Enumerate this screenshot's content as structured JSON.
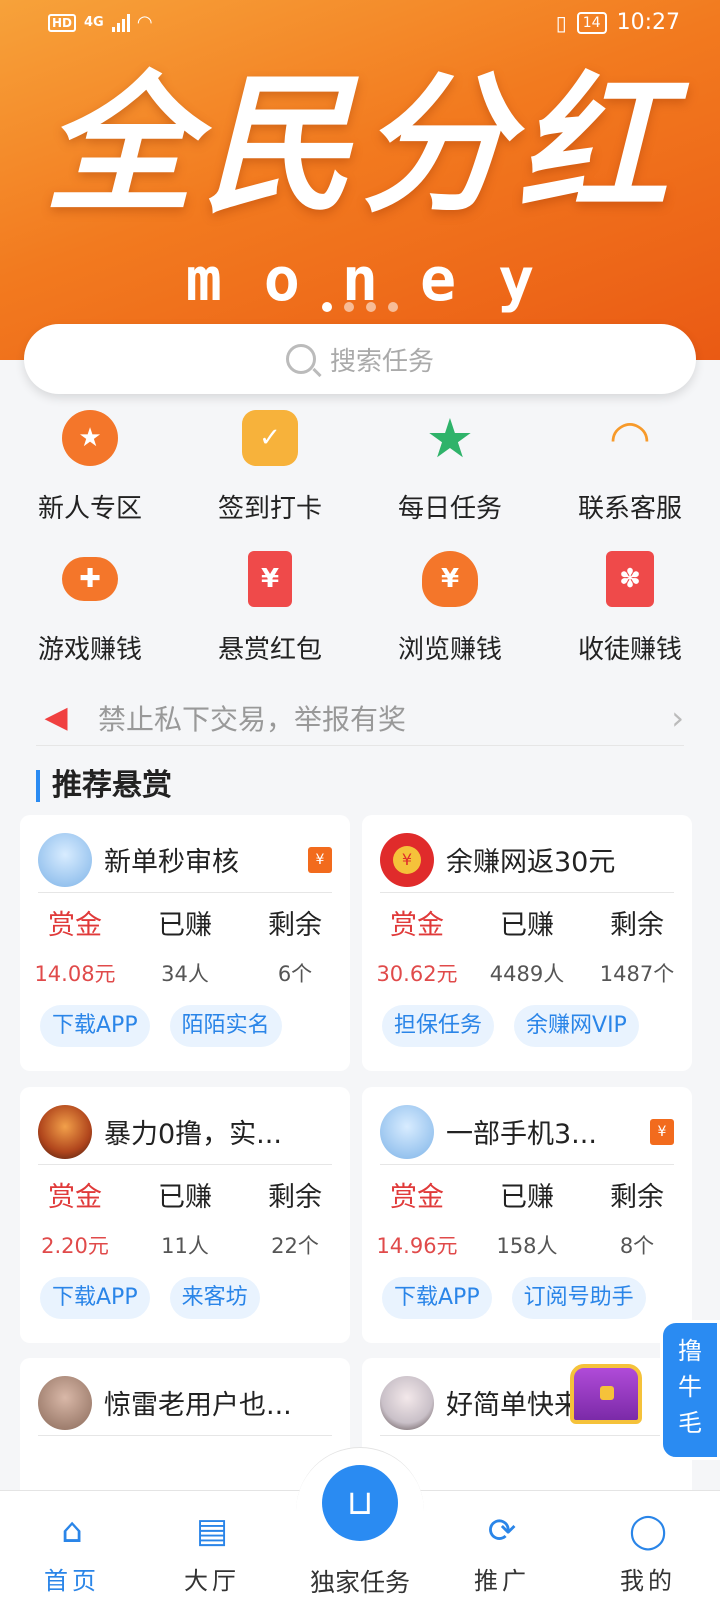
{
  "status_bar": {
    "network": "4G",
    "hd": "HD",
    "battery": "14",
    "time": "10:27"
  },
  "banner": {
    "title": "全民分红",
    "subtitle": "money"
  },
  "search": {
    "placeholder": "搜索任务"
  },
  "grid": [
    {
      "label": "新人专区",
      "icon": "medal-icon",
      "color": "#f4762a",
      "glyph": "★"
    },
    {
      "label": "签到打卡",
      "icon": "checkin-icon",
      "color": "#f7b23b",
      "glyph": "✓"
    },
    {
      "label": "每日任务",
      "icon": "star-icon",
      "color": "#2fb36a",
      "glyph": "★"
    },
    {
      "label": "联系客服",
      "icon": "headset-icon",
      "color": "#f79a2a",
      "glyph": "◠"
    },
    {
      "label": "游戏赚钱",
      "icon": "gamepad-icon",
      "color": "#f4762a",
      "glyph": "✚"
    },
    {
      "label": "悬赏红包",
      "icon": "red-packet-icon",
      "color": "#ef4a4a",
      "glyph": "¥"
    },
    {
      "label": "浏览赚钱",
      "icon": "money-bag-icon",
      "color": "#f4762a",
      "glyph": "¥"
    },
    {
      "label": "收徒赚钱",
      "icon": "gift-icon",
      "color": "#ef4a4a",
      "glyph": "✽"
    }
  ],
  "notice": {
    "text": "禁止私下交易，举报有奖"
  },
  "section": {
    "title": "推荐悬赏"
  },
  "stat_labels": {
    "reward": "赏金",
    "earned": "已赚",
    "remaining": "剩余"
  },
  "cards": [
    {
      "title": "新单秒审核",
      "reward": "14.08元",
      "earned": "34人",
      "remaining": "6个",
      "tags": [
        "下载APP",
        "陌陌实名"
      ],
      "avatar_color": "#7fb4e8",
      "red_packet": true
    },
    {
      "title": "余赚网返30元",
      "reward": "30.62元",
      "earned": "4489人",
      "remaining": "1487个",
      "tags": [
        "担保任务",
        "余赚网VIP"
      ],
      "avatar_color": "#e02b2b",
      "red_packet": false
    },
    {
      "title": "暴力0撸，实...",
      "reward": "2.20元",
      "earned": "11人",
      "remaining": "22个",
      "tags": [
        "下载APP",
        "来客坊"
      ],
      "avatar_color": "#b0451c",
      "red_packet": false
    },
    {
      "title": "一部手机3...",
      "reward": "14.96元",
      "earned": "158人",
      "remaining": "8个",
      "tags": [
        "下载APP",
        "订阅号助手"
      ],
      "avatar_color": "#7fb4e8",
      "red_packet": true
    },
    {
      "title": "惊雷老用户也...",
      "avatar_color": "#8a6a5a"
    },
    {
      "title": "好简单快来玩吖",
      "avatar_color": "#c9c0c8"
    }
  ],
  "float_button": {
    "label": "撸牛毛"
  },
  "tabbar": {
    "home": "首页",
    "hall": "大厅",
    "exclusive": "独家任务",
    "promote": "推广",
    "mine": "我的"
  }
}
